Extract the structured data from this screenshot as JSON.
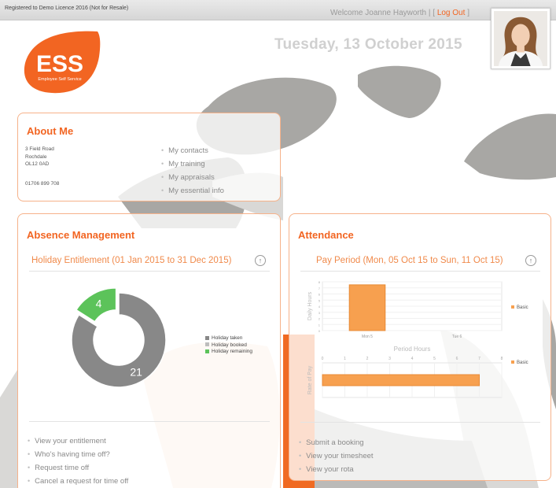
{
  "topbar": {
    "registration": "Registered to Demo Licence 2016 (Not for Resale)",
    "welcome_prefix": "Welcome Joanne Hayworth | [",
    "logout": "Log Out",
    "welcome_suffix": "]"
  },
  "header": {
    "date": "Tuesday, 13 October 2015"
  },
  "logo": {
    "text": "ESS",
    "tagline": "Employee Self Service",
    "color": "#f26522"
  },
  "about": {
    "title": "About Me",
    "address": [
      "3 Field Road",
      "Rochdale",
      "OL12 0AD"
    ],
    "phone": "01706 899 708",
    "links": [
      "My contacts",
      "My training",
      "My appraisals",
      "My essential info"
    ]
  },
  "absence": {
    "title": "Absence Management",
    "subtitle": "Holiday Entitlement (01 Jan 2015 to 31 Dec 2015)",
    "collapse_icon": "↑",
    "links": [
      "View your entitlement",
      "Who's having time off?",
      "Request time off",
      "Cancel a request for time off"
    ]
  },
  "attendance": {
    "title": "Attendance",
    "subtitle": "Pay Period (Mon, 05 Oct 15 to Sun, 11 Oct 15)",
    "collapse_icon": "↑",
    "links": [
      "Submit a booking",
      "View your timesheet",
      "View your rota"
    ]
  },
  "colors": {
    "accent": "#f26522",
    "taken": "#888888",
    "booked": "#bdbdbd",
    "remaining": "#5cc35a",
    "bar": "#f7a04f"
  },
  "chart_data": [
    {
      "type": "pie",
      "variant": "donut",
      "categories": [
        "Holiday taken",
        "Holiday booked",
        "Holiday remaining"
      ],
      "values": [
        21,
        0,
        4
      ],
      "data_labels": [
        "21",
        "",
        "4"
      ],
      "legend": "right"
    },
    {
      "type": "bar",
      "categories": [
        "Mon 5",
        "Tue 6"
      ],
      "series": [
        {
          "name": "Basic",
          "values": [
            7.5,
            0
          ]
        }
      ],
      "ylabel": "Daily Hours",
      "ylim": [
        0,
        8
      ],
      "yticks": [
        "0",
        "1",
        "2",
        "3",
        "4",
        "5",
        "6",
        "7",
        "8"
      ],
      "legend": "right"
    },
    {
      "type": "bar",
      "orientation": "horizontal",
      "categories": [
        ""
      ],
      "series": [
        {
          "name": "Basic",
          "values": [
            7
          ]
        }
      ],
      "xlabel": "Period Hours",
      "ylabel": "Rate of Pay",
      "xlim": [
        0,
        8
      ],
      "xticks": [
        "0",
        "1",
        "2",
        "3",
        "4",
        "5",
        "6",
        "7",
        "8"
      ],
      "legend": "right"
    }
  ]
}
